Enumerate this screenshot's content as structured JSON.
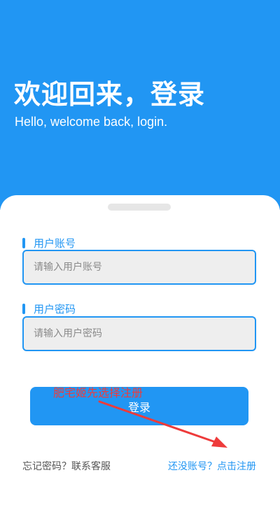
{
  "header": {
    "title": "欢迎回来，登录",
    "subtitle": "Hello, welcome back, login."
  },
  "form": {
    "username": {
      "label": "用户账号",
      "placeholder": "请输入用户账号",
      "value": ""
    },
    "password": {
      "label": "用户密码",
      "placeholder": "请输入用户密码",
      "value": ""
    },
    "login_label": "登录"
  },
  "annotation": {
    "text": "肥宅姬先选择注册",
    "color": "#ee3b3b"
  },
  "footer": {
    "forgot_label": "忘记密码？联系客服",
    "register_label": "还没账号？点击注册"
  },
  "colors": {
    "primary": "#2196f3",
    "input_bg": "#eeeeee",
    "annotation": "#ee3b3b"
  }
}
